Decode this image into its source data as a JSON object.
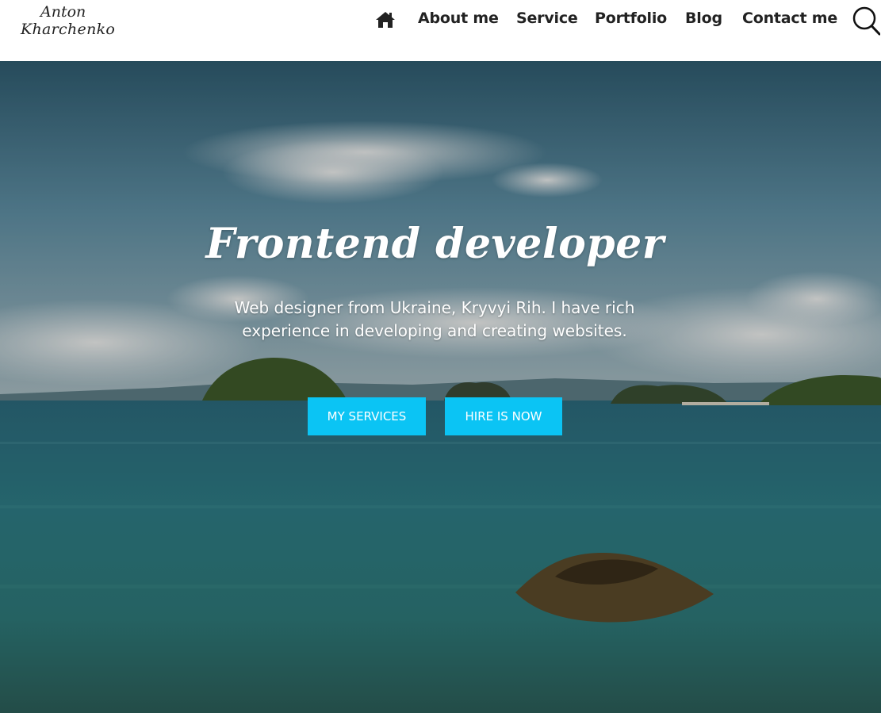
{
  "logo": {
    "line1": "Anton",
    "line2": "Kharchenko"
  },
  "nav": {
    "home_icon": "home-icon",
    "items": [
      {
        "label": "About me"
      },
      {
        "label": "Service"
      },
      {
        "label": "Portfolio"
      },
      {
        "label": "Blog"
      },
      {
        "label": "Contact me"
      }
    ],
    "search_icon": "search-icon"
  },
  "hero": {
    "title": "Frontend developer",
    "description": "Web designer from Ukraine, Kryvyi Rih. I have rich experience in developing and creating websites.",
    "buttons": [
      {
        "label": "MY SERVICES"
      },
      {
        "label": "HIRE IS NOW"
      }
    ]
  },
  "colors": {
    "accent": "#0bc4f4",
    "text_dark": "#222222",
    "header_bg": "#ffffff"
  }
}
